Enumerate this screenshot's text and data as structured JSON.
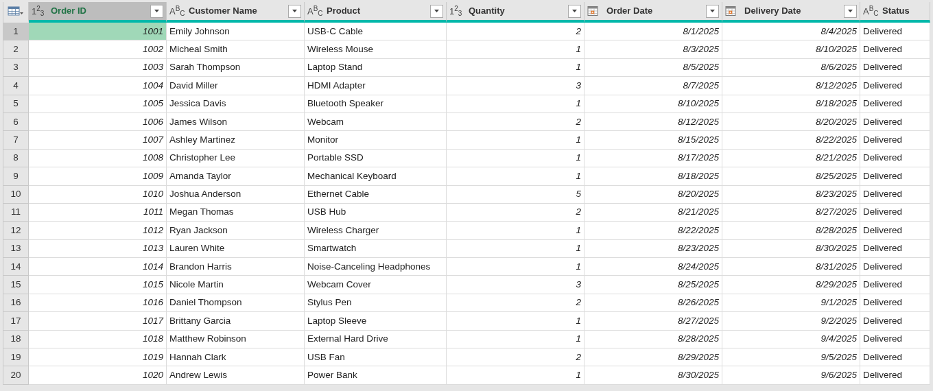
{
  "columns": [
    {
      "kind": "number",
      "type_label": "1$^{2}$$_{3}$",
      "name": "Order ID",
      "selected": true
    },
    {
      "kind": "text",
      "type_label": "A$^{B}$$_{C}$",
      "name": "Customer Name",
      "selected": false
    },
    {
      "kind": "text",
      "type_label": "A$^{B}$$_{C}$",
      "name": "Product",
      "selected": false
    },
    {
      "kind": "number",
      "type_label": "1$^{2}$$_{3}$",
      "name": "Quantity",
      "selected": false
    },
    {
      "kind": "date",
      "name": "Order Date",
      "selected": false
    },
    {
      "kind": "date",
      "name": "Delivery Date",
      "selected": false
    },
    {
      "kind": "text",
      "type_label": "A$^{B}$$_{C}$",
      "name": "Status",
      "selected": false
    }
  ],
  "rows": [
    {
      "number": "1",
      "selected": true,
      "cells": [
        "1001",
        "Emily Johnson",
        "USB-C Cable",
        "2",
        "8/1/2025",
        "8/4/2025",
        "Delivered"
      ]
    },
    {
      "number": "2",
      "selected": false,
      "cells": [
        "1002",
        "Micheal Smith",
        "Wireless Mouse",
        "1",
        "8/3/2025",
        "8/10/2025",
        "Delivered"
      ]
    },
    {
      "number": "3",
      "selected": false,
      "cells": [
        "1003",
        "Sarah Thompson",
        "Laptop Stand",
        "1",
        "8/5/2025",
        "8/6/2025",
        "Delivered"
      ]
    },
    {
      "number": "4",
      "selected": false,
      "cells": [
        "1004",
        "David Miller",
        "HDMI Adapter",
        "3",
        "8/7/2025",
        "8/12/2025",
        "Delivered"
      ]
    },
    {
      "number": "5",
      "selected": false,
      "cells": [
        "1005",
        "Jessica Davis",
        "Bluetooth Speaker",
        "1",
        "8/10/2025",
        "8/18/2025",
        "Delivered"
      ]
    },
    {
      "number": "6",
      "selected": false,
      "cells": [
        "1006",
        "James Wilson",
        "Webcam",
        "2",
        "8/12/2025",
        "8/20/2025",
        "Delivered"
      ]
    },
    {
      "number": "7",
      "selected": false,
      "cells": [
        "1007",
        "Ashley Martinez",
        "Monitor",
        "1",
        "8/15/2025",
        "8/22/2025",
        "Delivered"
      ]
    },
    {
      "number": "8",
      "selected": false,
      "cells": [
        "1008",
        "Christopher Lee",
        "Portable SSD",
        "1",
        "8/17/2025",
        "8/21/2025",
        "Delivered"
      ]
    },
    {
      "number": "9",
      "selected": false,
      "cells": [
        "1009",
        "Amanda Taylor",
        "Mechanical Keyboard",
        "1",
        "8/18/2025",
        "8/25/2025",
        "Delivered"
      ]
    },
    {
      "number": "10",
      "selected": false,
      "cells": [
        "1010",
        "Joshua Anderson",
        "Ethernet Cable",
        "5",
        "8/20/2025",
        "8/23/2025",
        "Delivered"
      ]
    },
    {
      "number": "11",
      "selected": false,
      "cells": [
        "1011",
        "Megan Thomas",
        "USB Hub",
        "2",
        "8/21/2025",
        "8/27/2025",
        "Delivered"
      ]
    },
    {
      "number": "12",
      "selected": false,
      "cells": [
        "1012",
        "Ryan Jackson",
        "Wireless Charger",
        "1",
        "8/22/2025",
        "8/28/2025",
        "Delivered"
      ]
    },
    {
      "number": "13",
      "selected": false,
      "cells": [
        "1013",
        "Lauren White",
        "Smartwatch",
        "1",
        "8/23/2025",
        "8/30/2025",
        "Delivered"
      ]
    },
    {
      "number": "14",
      "selected": false,
      "cells": [
        "1014",
        "Brandon Harris",
        "Noise-Canceling Headphones",
        "1",
        "8/24/2025",
        "8/31/2025",
        "Delivered"
      ]
    },
    {
      "number": "15",
      "selected": false,
      "cells": [
        "1015",
        "Nicole Martin",
        "Webcam Cover",
        "3",
        "8/25/2025",
        "8/29/2025",
        "Delivered"
      ]
    },
    {
      "number": "16",
      "selected": false,
      "cells": [
        "1016",
        "Daniel Thompson",
        "Stylus Pen",
        "2",
        "8/26/2025",
        "9/1/2025",
        "Delivered"
      ]
    },
    {
      "number": "17",
      "selected": false,
      "cells": [
        "1017",
        "Brittany Garcia",
        "Laptop Sleeve",
        "1",
        "8/27/2025",
        "9/2/2025",
        "Delivered"
      ]
    },
    {
      "number": "18",
      "selected": false,
      "cells": [
        "1018",
        "Matthew Robinson",
        "External Hard Drive",
        "1",
        "8/28/2025",
        "9/4/2025",
        "Delivered"
      ]
    },
    {
      "number": "19",
      "selected": false,
      "cells": [
        "1019",
        "Hannah Clark",
        "USB Fan",
        "2",
        "8/29/2025",
        "9/5/2025",
        "Delivered"
      ]
    },
    {
      "number": "20",
      "selected": false,
      "cells": [
        "1020",
        "Andrew Lewis",
        "Power Bank",
        "1",
        "8/30/2025",
        "9/6/2025",
        "Delivered"
      ]
    }
  ]
}
